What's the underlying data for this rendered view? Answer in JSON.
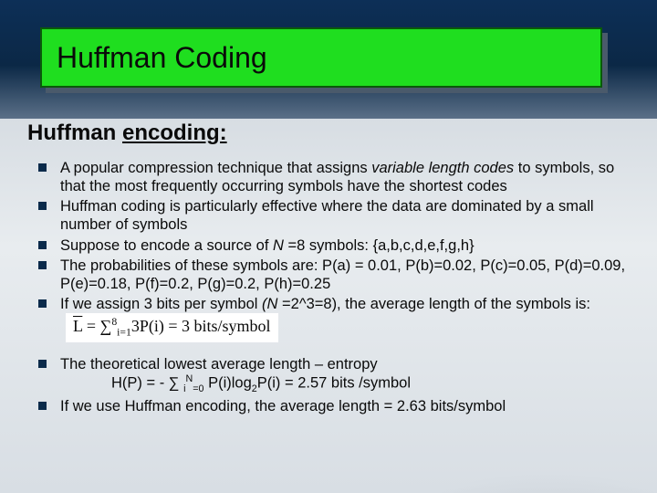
{
  "title": "Huffman Coding",
  "subheading_prefix": "Huffman ",
  "subheading_underlined": "encoding:",
  "bullets": [
    {
      "pre": "A popular compression technique that assigns ",
      "em": "variable length codes",
      "post": " to symbols, so that the most frequently occurring symbols have the shortest codes"
    },
    {
      "text": "Huffman coding is particularly effective where the data are dominated by a small number of symbols"
    },
    {
      "pre": "Suppose to encode a source of ",
      "em": "N",
      "post": " =8 symbols:    {a,b,c,d,e,f,g,h}"
    },
    {
      "text": "The probabilities of these symbols are: P(a) = 0.01, P(b)=0.02, P(c)=0.05, P(d)=0.09, P(e)=0.18, P(f)=0.2, P(g)=0.2, P(h)=0.25"
    },
    {
      "pre": "If we assign 3 bits per symbol ",
      "em": "(N",
      "post": " =2^3=8), the average length of the symbols is:",
      "formula": {
        "lhs_bar": "L",
        "eq": " = ∑",
        "sub1": "i=1",
        "sup1": "8",
        "mid": "3P(i) = 3",
        "unit": " bits/symbol"
      }
    }
  ],
  "bullets2": [
    {
      "text": "The theoretical lowest average length – entropy",
      "indent_line": {
        "pre": "H(P) = - ∑ ",
        "sub": "i",
        "supN": "N",
        "subeq": "=0",
        "post": " P(i)log",
        "logsub": "2",
        "tail": "P(i) = 2.57 bits /symbol"
      }
    },
    {
      "text": "If we use Huffman encoding, the average length = 2.63 bits/symbol"
    }
  ]
}
